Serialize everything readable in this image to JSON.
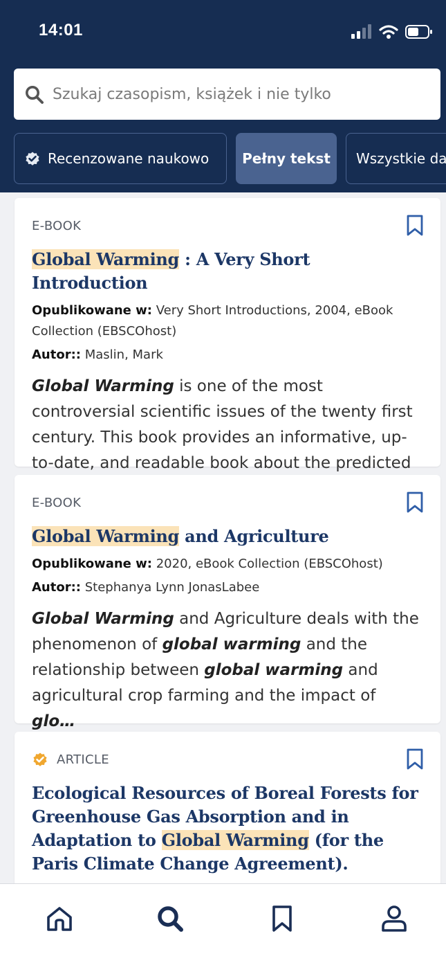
{
  "status": {
    "time": "14:01"
  },
  "search": {
    "placeholder": "Szukaj czasopism, książek i nie tylko"
  },
  "filters": [
    {
      "label": "Recenzowane naukowo"
    },
    {
      "label": "Pełny tekst"
    },
    {
      "label": "Wszystkie daty"
    }
  ],
  "results": [
    {
      "type": "E-BOOK",
      "title_highlight": "Global Warming",
      "title_rest": " : A Very Short Introduction",
      "published_label": "Opublikowane w:",
      "published_value": " Very Short Introductions, 2004, eBook Collection (EBSCOhost)",
      "author_label": "Autor::",
      "author_value": " Maslin, Mark",
      "abstract_em": "Global Warming",
      "abstract_rest": " is one of the most controversial scientific issues of the twenty first century. This book provides an informative, up-to-date, and readable book about the predicted impacts of…"
    },
    {
      "type": "E-BOOK",
      "title_highlight": "Global Warming",
      "title_rest": " and Agriculture",
      "published_label": "Opublikowane w:",
      "published_value": " 2020, eBook Collection (EBSCOhost)",
      "author_label": "Autor::",
      "author_value": " Stephanya Lynn JonasLabee",
      "abstract_parts": [
        "Global Warming",
        " and Agriculture deals with the phenomenon of ",
        "global warming",
        " and the relationship between ",
        "global warming",
        " and agricultural crop farming and the impact of ",
        "glo…"
      ]
    },
    {
      "type": "ARTICLE",
      "title_before": "Ecological Resources of Boreal Forests for Greenhouse Gas Absorption and in Adaptation to ",
      "title_highlight": "Global Warming",
      "title_after": " (for the Paris Climate Change Agreement)."
    }
  ],
  "colors": {
    "header": "#162d52",
    "accent": "#1c3766",
    "highlight": "#fbe3b8",
    "verified": "#f0a72f",
    "chip_active": "#4a6390"
  },
  "icons": {
    "search": "search-icon",
    "verified": "verified-badge-icon",
    "bookmark": "bookmark-icon",
    "home": "home-icon",
    "profile": "profile-icon"
  }
}
